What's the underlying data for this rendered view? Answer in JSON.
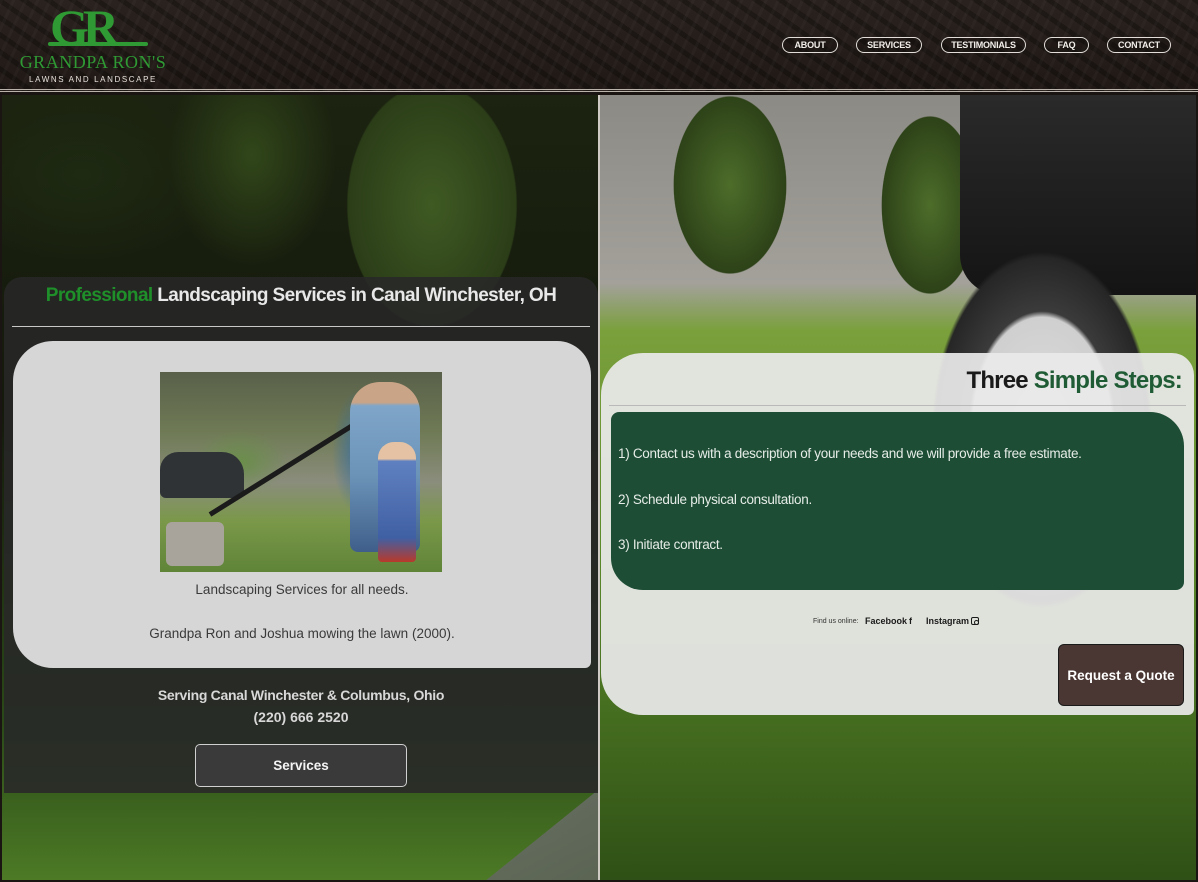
{
  "brand": {
    "mark": "GR",
    "name": "GRANDPA RON'S",
    "tagline": "LAWNS AND LANDSCAPE"
  },
  "nav": {
    "items": [
      {
        "label": "ABOUT"
      },
      {
        "label": "SERVICES"
      },
      {
        "label": "TESTIMONIALS"
      },
      {
        "label": "FAQ"
      },
      {
        "label": "CONTACT"
      }
    ]
  },
  "hero": {
    "title_highlight": "Professional",
    "title_rest": " Landscaping Services in Canal Winchester, OH",
    "caption_main": "Landscaping Services for all needs.",
    "caption_photo": "Grandpa Ron and Joshua mowing the lawn (2000).",
    "serving": "Serving Canal Winchester & Columbus, Ohio",
    "phone": "(220) 666 2520",
    "services_button": "Services"
  },
  "steps": {
    "title_plain": "Three ",
    "title_highlight": "Simple Steps:",
    "items": [
      {
        "text": "1) Contact us with a description of your needs and we will provide a free estimate."
      },
      {
        "text": "2) Schedule physical consultation."
      },
      {
        "text": "3) Initiate contract."
      }
    ],
    "find_us": "Find us online:",
    "facebook": "Facebook",
    "instagram": "Instagram",
    "quote_button": "Request a Quote"
  },
  "colors": {
    "brand_green": "#2f9a34",
    "steps_green": "#1d4d34",
    "quote_brown": "#4a3632"
  }
}
